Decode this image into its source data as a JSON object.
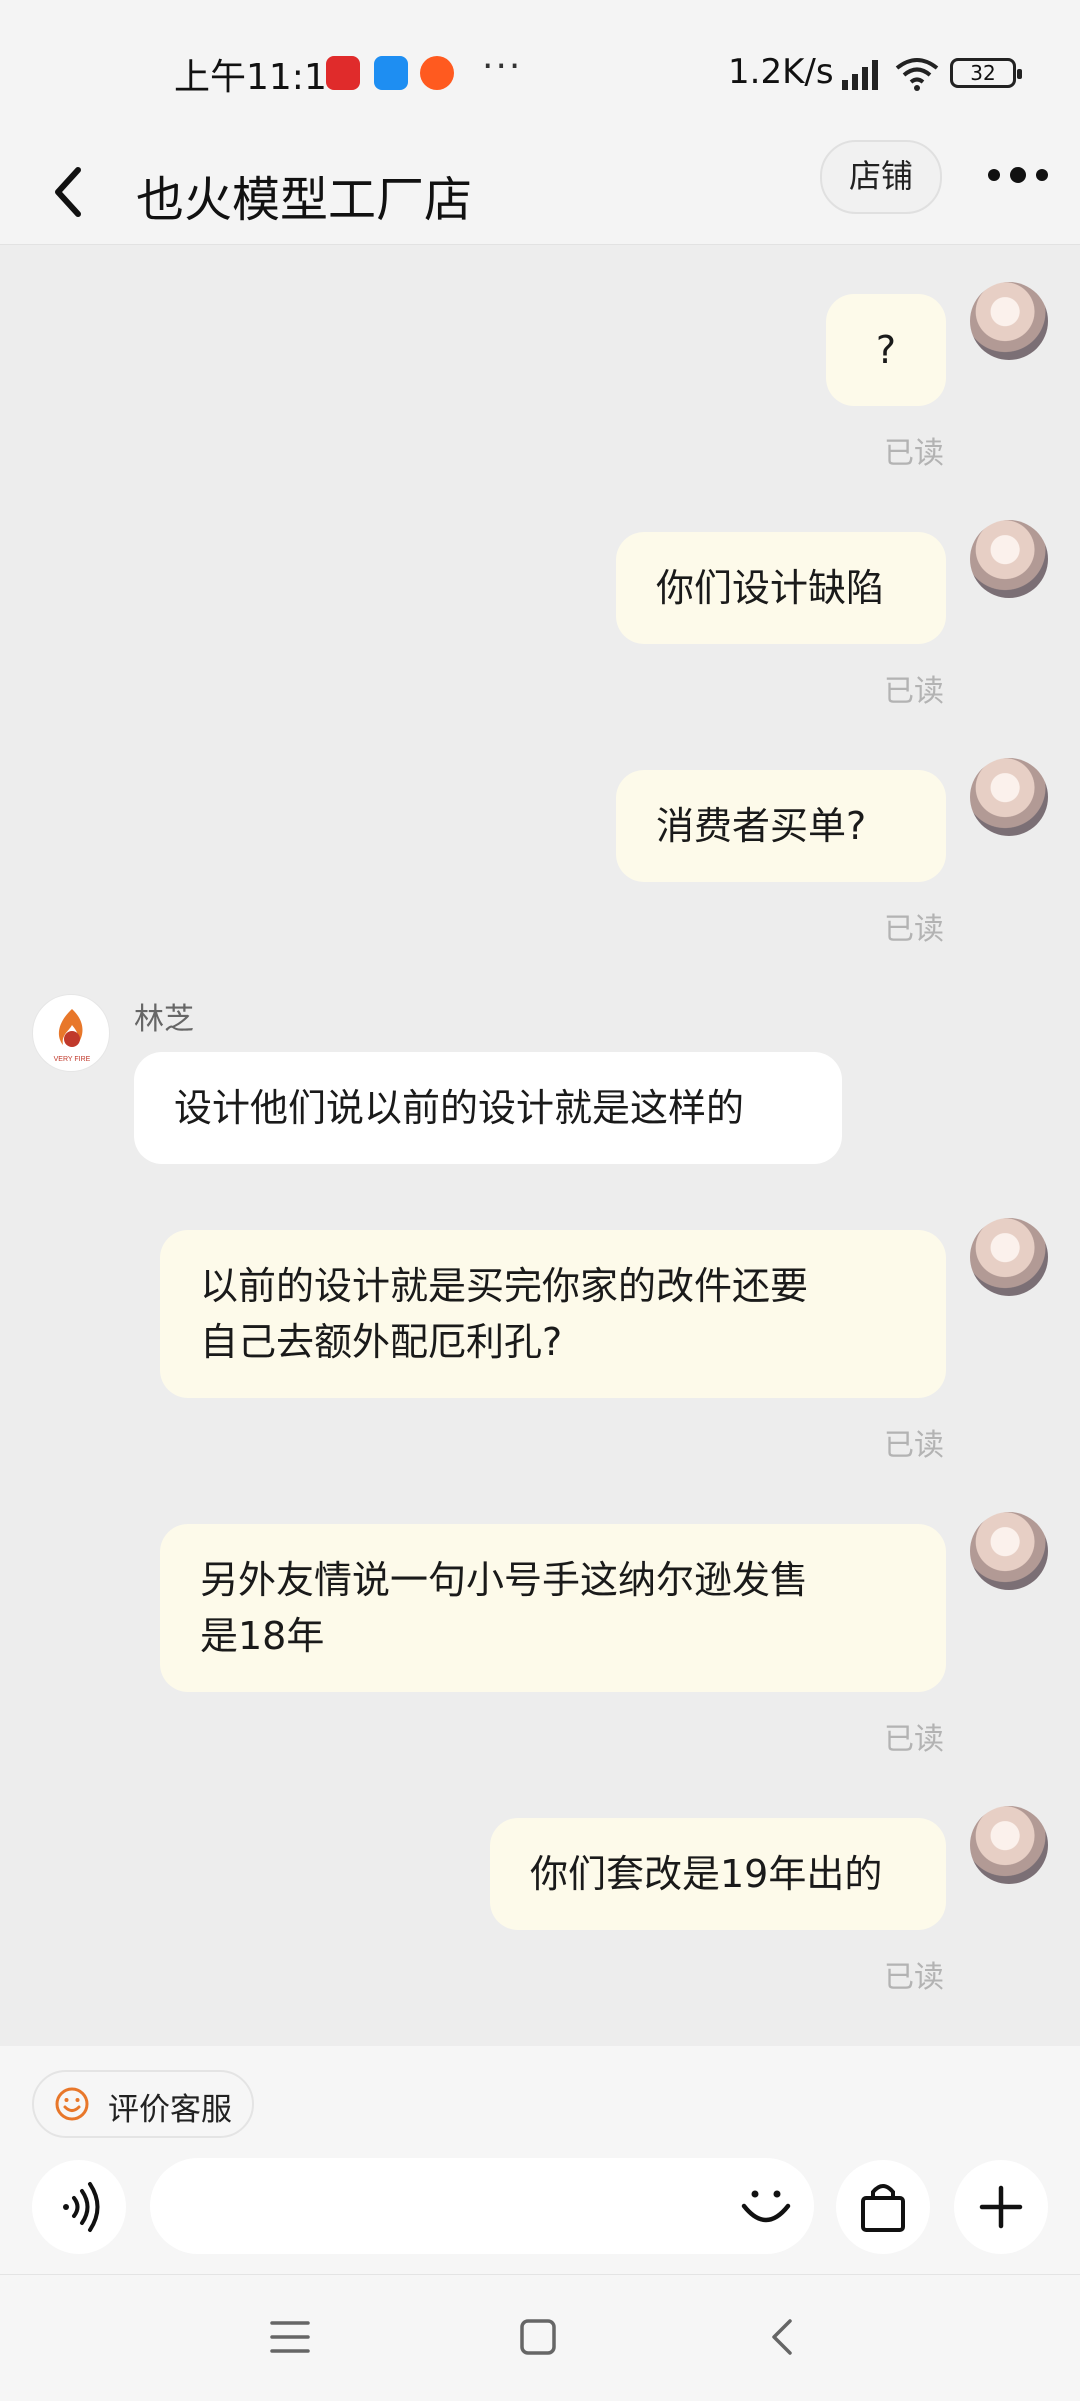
{
  "status_bar": {
    "time": "上午11:13",
    "more": "···",
    "network_speed": "1.2K/s",
    "battery": "32",
    "icons": [
      "netease-music-icon",
      "message-app-icon",
      "taobao-icon",
      "signal-icon",
      "wifi-icon",
      "battery-icon"
    ]
  },
  "header": {
    "title": "也火模型工厂店",
    "store_button": "店铺",
    "icons": [
      "back-arrow-icon",
      "more-dots-icon"
    ]
  },
  "chat": {
    "read_label": "已读",
    "shop_sender_name": "林芝",
    "shop_logo_text": "VERY FIRE",
    "messages": [
      {
        "from": "me",
        "lines": [
          "?"
        ],
        "status": "已读"
      },
      {
        "from": "me",
        "lines": [
          "你们设计缺陷"
        ],
        "status": "已读"
      },
      {
        "from": "me",
        "lines": [
          "消费者买单?"
        ],
        "status": "已读"
      },
      {
        "from": "shop",
        "sender": "林芝",
        "lines": [
          "设计他们说以前的设计就是这样的"
        ]
      },
      {
        "from": "me",
        "lines": [
          "以前的设计就是买完你家的改件还要",
          "自己去额外配厄利孔?"
        ],
        "status": "已读"
      },
      {
        "from": "me",
        "lines": [
          "另外友情说一句小号手这纳尔逊发售",
          "是18年"
        ],
        "status": "已读"
      },
      {
        "from": "me",
        "lines": [
          "你们套改是19年出的"
        ],
        "status": "已读"
      }
    ]
  },
  "bottom_bar": {
    "rate_button": "评价客服",
    "input_placeholder": "",
    "icons": [
      "smiley-icon",
      "voice-icon",
      "emoji-icon",
      "shopping-bag-icon",
      "plus-icon"
    ]
  },
  "nav_bar": {
    "icons": [
      "menu-icon",
      "home-square-icon",
      "back-triangle-icon"
    ]
  },
  "colors": {
    "background": "#ededed",
    "my_bubble": "#fdfaea",
    "shop_bubble": "#ffffff",
    "read_text": "#b3b3b3",
    "accent_orange": "#e8772a"
  }
}
